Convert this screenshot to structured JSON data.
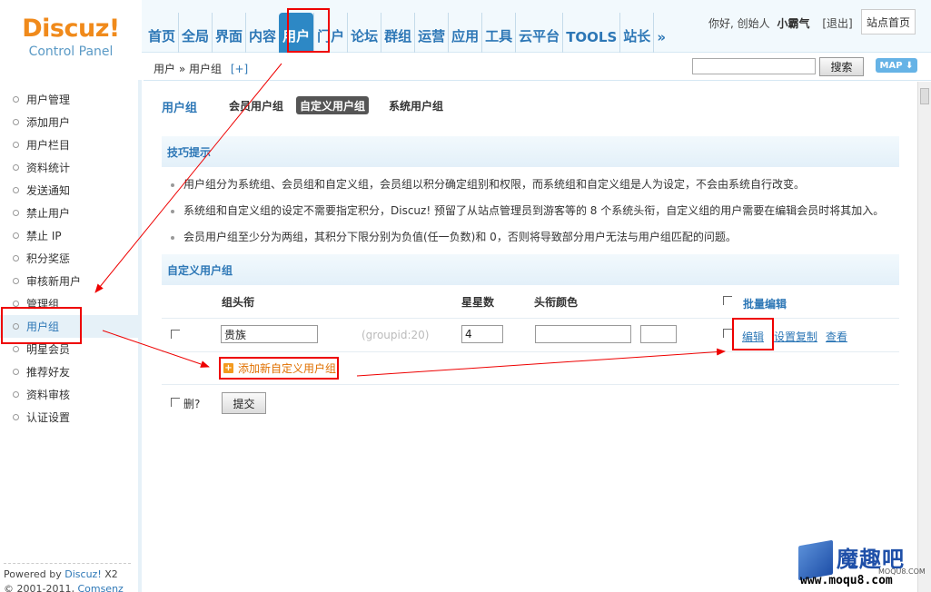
{
  "logo": {
    "brand": "Discuz!",
    "sub": "Control Panel"
  },
  "topnav": [
    "首页",
    "全局",
    "界面",
    "内容",
    "用户",
    "门户",
    "论坛",
    "群组",
    "运营",
    "应用",
    "工具",
    "云平台",
    "TOOLS",
    "站长",
    "»"
  ],
  "topnav_active": "用户",
  "user": {
    "greeting": "你好, 创始人",
    "name": "小霸气",
    "logout": "[退出]",
    "site_home": "站点首页"
  },
  "breadcrumb": {
    "path": "用户 » 用户组",
    "add": "[+]"
  },
  "search": {
    "button": "搜索",
    "map": "MAP ⬇"
  },
  "sidebar": {
    "items": [
      "用户管理",
      "添加用户",
      "用户栏目",
      "资料统计",
      "发送通知",
      "禁止用户",
      "禁止 IP",
      "积分奖惩",
      "审核新用户",
      "管理组",
      "用户组",
      "明星会员",
      "推荐好友",
      "资料审核",
      "认证设置"
    ],
    "active": "用户组"
  },
  "footer": {
    "line1_prefix": "Powered by ",
    "line1_link": "Discuz!",
    "line1_suffix": " X2",
    "line2_prefix": "© 2001-2011, ",
    "line2_link": "Comsenz Inc."
  },
  "page": {
    "title": "用户组",
    "subtabs": [
      "会员用户组",
      "自定义用户组",
      "系统用户组"
    ],
    "active_subtab": "自定义用户组"
  },
  "tips": {
    "header": "技巧提示",
    "items": [
      "用户组分为系统组、会员组和自定义组，会员组以积分确定组别和权限，而系统组和自定义组是人为设定，不会由系统自行改变。",
      "系统组和自定义组的设定不需要指定积分，Discuz! 预留了从站点管理员到游客等的 8 个系统头衔，自定义组的用户需要在编辑会员时将其加入。",
      "会员用户组至少分为两组，其积分下限分别为负值(任一负数)和 0，否则将导致部分用户无法与用户组匹配的问题。"
    ]
  },
  "custom": {
    "header": "自定义用户组",
    "columns": {
      "title": "组头衔",
      "stars": "星星数",
      "color": "头衔颜色",
      "batch": "批量编辑"
    },
    "rows": [
      {
        "name": "贵族",
        "groupid": "(groupid:20)",
        "stars": "4",
        "color": "",
        "edit": "编辑",
        "copy": "设置复制",
        "view": "查看"
      }
    ],
    "add_label": "添加新自定义用户组",
    "delete_label": "删?",
    "submit_label": "提交"
  },
  "watermark": {
    "text": "魔趣吧",
    "sub": "MOQU8.COM",
    "url": "www.moqu8.com"
  },
  "colors": {
    "accent": "#2d77b6",
    "nav_active": "#2d88c5",
    "annotation": "#e00000",
    "logo": "#f08a1b"
  }
}
